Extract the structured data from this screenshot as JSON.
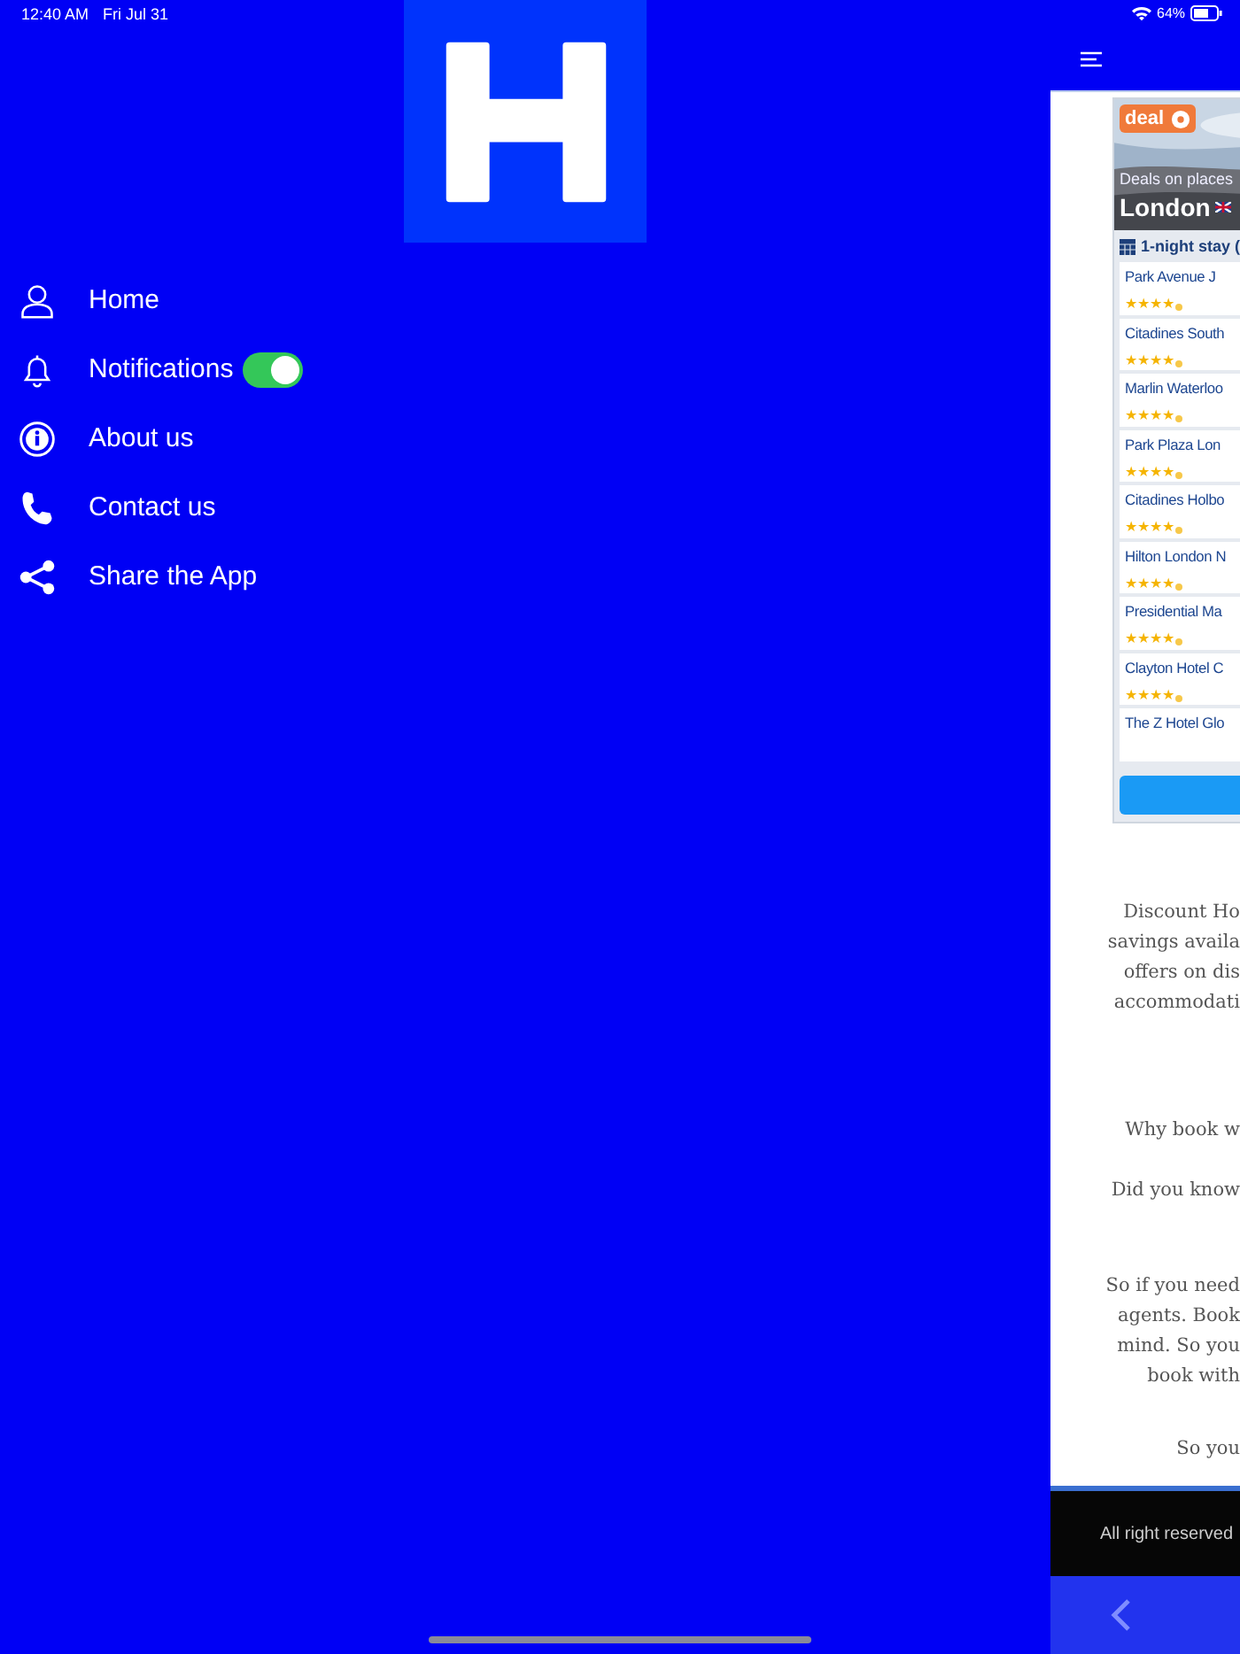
{
  "status_bar": {
    "time": "12:40 AM",
    "date": "Fri Jul 31",
    "battery_text": "64%"
  },
  "menu": [
    {
      "label": "Home",
      "kind": "link"
    },
    {
      "label": "Notifications",
      "kind": "toggle",
      "on": true
    },
    {
      "label": "About us",
      "kind": "link"
    },
    {
      "label": "Contact us",
      "kind": "link"
    },
    {
      "label": "Share the App",
      "kind": "link"
    }
  ],
  "deal_widget": {
    "badge": "deal",
    "subtitle": "Deals on places",
    "city": "London",
    "stay": "1-night stay (",
    "hotels": [
      {
        "name": "Park Avenue J",
        "stars": 4
      },
      {
        "name": "Citadines South",
        "stars": 4
      },
      {
        "name": "Marlin Waterloo",
        "stars": 4
      },
      {
        "name": "Park Plaza Lon",
        "stars": 4
      },
      {
        "name": "Citadines Holbo",
        "stars": 4
      },
      {
        "name": "Hilton London N",
        "stars": 4
      },
      {
        "name": "Presidential Ma",
        "stars": 4
      },
      {
        "name": "Clayton Hotel C",
        "stars": 4
      },
      {
        "name": "The Z Hotel Glo"
      }
    ]
  },
  "paragraphs": [
    {
      "lines": [
        "Discount Ho",
        "savings availa",
        "offers on dis",
        "accommodati"
      ]
    },
    {
      "lines": [
        "Why book w"
      ]
    },
    {
      "lines": [
        "Did you know"
      ]
    },
    {
      "lines": [
        "So if you need",
        "agents. Book",
        "mind. So you",
        "book with"
      ]
    },
    {
      "lines": [
        "So you"
      ]
    }
  ],
  "footer": {
    "text": "All right reserved"
  }
}
